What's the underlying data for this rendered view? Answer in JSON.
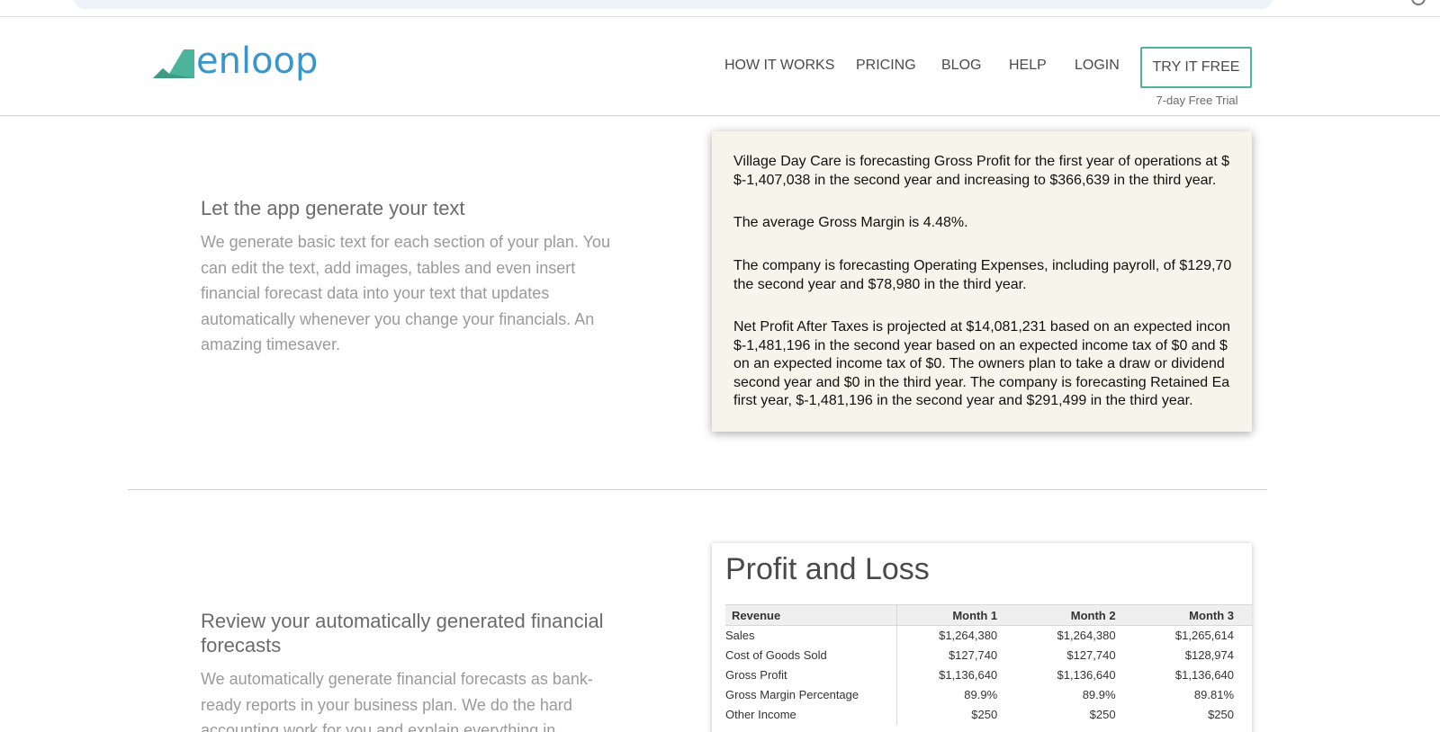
{
  "header": {
    "logo_text": "enloop",
    "nav": {
      "how_it_works": "HOW IT WORKS",
      "pricing": "PRICING",
      "blog": "BLOG",
      "help": "HELP",
      "login": "LOGIN"
    },
    "cta_label": "TRY IT FREE",
    "cta_note": "7-day Free Trial"
  },
  "colors": {
    "brand_blue": "#3a95c9",
    "brand_green": "#4bb49a"
  },
  "section1": {
    "title": "Let the app generate your text",
    "description": "We generate basic text for each section of your plan. You can edit the text, add images, tables and even insert financial forecast data into your text that updates automatically whenever you change your financials. An amazing timesaver.",
    "sample_text": {
      "p1_line1": "Village Day Care is forecasting Gross Profit for the first year of operations at $",
      "p1_line2": "$-1,407,038 in the second year and increasing to $366,639 in the third year.",
      "p2_line1": "The average Gross Margin is 4.48%.",
      "p3_line1": "The company is forecasting Operating Expenses, including payroll, of $129,70",
      "p3_line2": "the second year and $78,980 in the third year.",
      "p4_line1": "Net Profit After Taxes is projected at $14,081,231 based on an expected incon",
      "p4_line2": "$-1,481,196 in the second year based on an expected income tax of $0 and $",
      "p4_line3": "on an expected income tax of $0. The owners plan to take a draw or dividend",
      "p4_line4": "second year and $0 in the third year. The company is forecasting Retained Ea",
      "p4_line5": "first year, $-1,481,196 in the second year and $291,499 in the third year."
    }
  },
  "section2": {
    "title": "Review your automatically generated financial forecasts",
    "description": "We automatically generate financial forecasts as bank-ready reports in your business plan. We do the hard accounting work for you and explain everything in"
  },
  "profit_loss": {
    "title": "Profit and Loss",
    "headers": [
      "Revenue",
      "Month 1",
      "Month 2",
      "Month 3"
    ],
    "rows": [
      [
        "Sales",
        "$1,264,380",
        "$1,264,380",
        "$1,265,614"
      ],
      [
        "Cost of Goods Sold",
        "$127,740",
        "$127,740",
        "$128,974"
      ],
      [
        "Gross Profit",
        "$1,136,640",
        "$1,136,640",
        "$1,136,640"
      ],
      [
        "Gross Margin Percentage",
        "89.9%",
        "89.9%",
        "89.81%"
      ],
      [
        "Other Income",
        "$250",
        "$250",
        "$250"
      ]
    ]
  }
}
